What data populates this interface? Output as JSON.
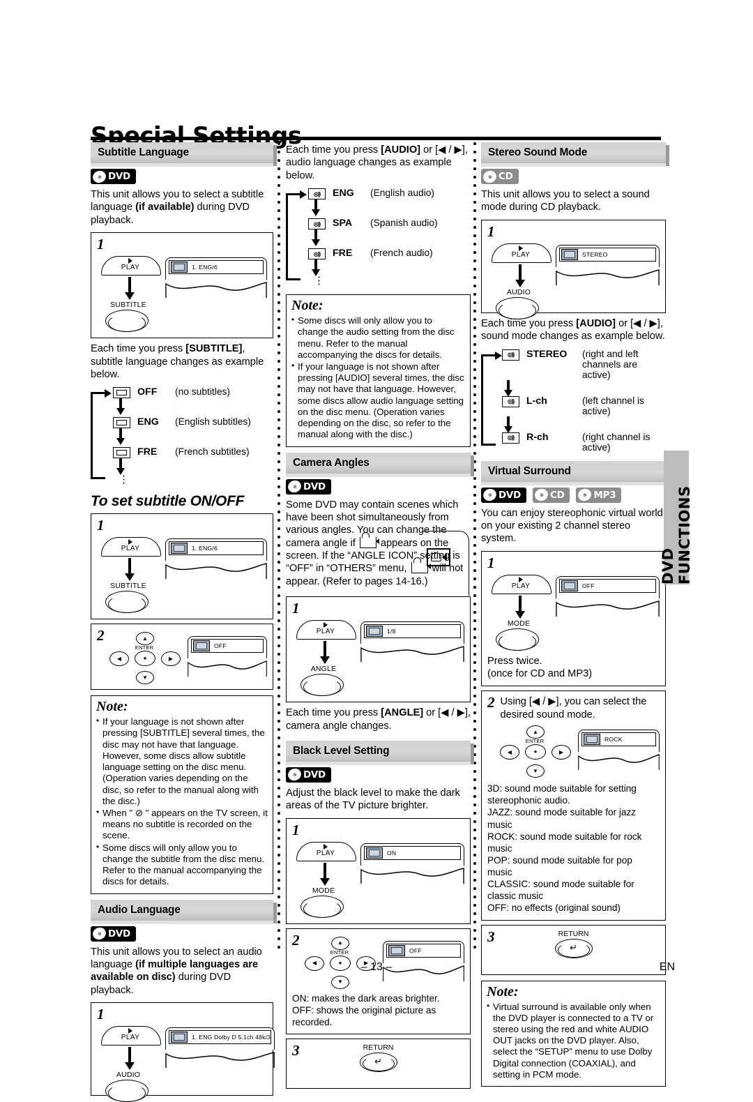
{
  "page": {
    "title": "Special Settings",
    "page_number": "– 13 –",
    "language_mark": "EN",
    "side_tab": "DVD FUNCTIONS"
  },
  "badges": {
    "dvd": "DVD",
    "cd": "CD",
    "mp3": "MP3"
  },
  "keys": {
    "play": "PLAY",
    "subtitle": "SUBTITLE",
    "audio": "AUDIO",
    "angle": "ANGLE",
    "mode": "MODE",
    "return": "RETURN",
    "enter": "ENTER"
  },
  "subtitle_language": {
    "heading": "Subtitle Language",
    "intro_a": "This unit allows you to select a subtitle language ",
    "intro_b": "(if available)",
    "intro_c": " during DVD playback.",
    "step1_num": "1",
    "osd_text": "1. ENG/6",
    "press_text_a": "Each time you press ",
    "press_text_b": "[SUBTITLE]",
    "press_text_c": ", subtitle language changes as example below.",
    "cycle": [
      {
        "code": "OFF",
        "desc": "(no subtitles)"
      },
      {
        "code": "ENG",
        "desc": "(English subtitles)"
      },
      {
        "code": "FRE",
        "desc": "(French subtitles)"
      }
    ],
    "onoff_heading": "To set subtitle ON/OFF",
    "onoff_step1_num": "1",
    "onoff_step1_osd": "1. ENG/6",
    "onoff_step2_num": "2",
    "onoff_step2_osd": "OFF",
    "note_title": "Note:",
    "notes": [
      "If your language is not shown after pressing [SUBTITLE] several times, the disc may not have that language. However, some discs allow subtitle language setting on the disc menu. (Operation varies depending on the disc, so refer to the manual along with the disc.)",
      "When \" ⊘ \" appears on the TV screen, it means no subtitle is recorded on the scene.",
      "Some discs will only allow you to change the subtitle from the disc menu. Refer to the manual accompanying the discs for details."
    ]
  },
  "audio_language": {
    "heading": "Audio Language",
    "intro_a": "This unit allows you to select an audio language ",
    "intro_b": "(if multiple languages are available on disc)",
    "intro_c": " during DVD playback.",
    "step1_num": "1",
    "osd_text": "1. ENG  Dolby D  5.1ch  48k/3",
    "press_text_a": "Each time you press ",
    "press_text_b": "[AUDIO]",
    "press_text_c": " or [◀ / ▶], audio language changes as example below.",
    "cycle": [
      {
        "code": "ENG",
        "desc": "(English audio)"
      },
      {
        "code": "SPA",
        "desc": "(Spanish audio)"
      },
      {
        "code": "FRE",
        "desc": "(French audio)"
      }
    ],
    "note_title": "Note:",
    "notes": [
      "Some discs will only allow you to change the audio setting from the disc menu. Refer to the manual accompanying the discs for details.",
      "If your language is not shown after pressing [AUDIO] several times, the disc may not have that language. However, some discs allow audio language setting on the disc menu. (Operation varies depending on the disc, so refer to the manual along with the disc.)"
    ]
  },
  "camera_angles": {
    "heading": "Camera Angles",
    "text_1": "Some DVD may contain scenes which have been shot simultaneously from various angles. You can change the camera angle if ",
    "text_2": " appears on the screen. If the “ANGLE ICON” setting is “OFF” in “OTHERS” menu, ",
    "text_3": " will not appear. (Refer to pages 14-16.)",
    "step1_num": "1",
    "osd_text": "1/8",
    "press_text_a": "Each time you press ",
    "press_text_b": "[ANGLE]",
    "press_text_c": " or [◀ / ▶], camera angle changes."
  },
  "black_level": {
    "heading": "Black Level Setting",
    "intro": "Adjust the black level to make the dark areas of the TV picture brighter.",
    "step1_num": "1",
    "step1_osd": "ON",
    "step2_num": "2",
    "step2_osd": "OFF",
    "desc_on": "ON: makes the dark areas brighter.",
    "desc_off": "OFF: shows the original picture as recorded.",
    "step3_num": "3"
  },
  "stereo_sound_mode": {
    "heading": "Stereo Sound Mode",
    "intro": "This unit allows you to select a sound mode during CD playback.",
    "step1_num": "1",
    "osd_text": "STEREO",
    "press_text_a": "Each time you press ",
    "press_text_b": "[AUDIO]",
    "press_text_c": " or [◀ / ▶], sound mode changes as example below.",
    "cycle": [
      {
        "code": "STEREO",
        "desc": "(right and left channels are active)"
      },
      {
        "code": "L-ch",
        "desc": "(left channel is active)"
      },
      {
        "code": "R-ch",
        "desc": "(right channel is active)"
      }
    ]
  },
  "virtual_surround": {
    "heading": "Virtual Surround",
    "intro": "You can enjoy stereophonic virtual world on your existing 2 channel stereo system.",
    "step1_num": "1",
    "step1_osd": "OFF",
    "step1_note_1": "Press twice.",
    "step1_note_2": "(once for CD and MP3)",
    "step2_num": "2",
    "step2_text": "Using [◀ / ▶], you can select the desired sound mode.",
    "step2_osd": "ROCK",
    "modes": [
      "3D: sound mode suitable for setting        stereophonic audio.",
      "JAZZ: sound mode suitable for jazz           music",
      "ROCK: sound mode suitable for rock music",
      "POP: sound mode suitable for pop music",
      "CLASSIC: sound mode suitable for                  classic music",
      "OFF: no effects (original sound)"
    ],
    "step3_num": "3",
    "note_title": "Note:",
    "notes": [
      "Virtual surround is available only when the DVD player is connected to a TV or stereo using the red and white AUDIO OUT jacks on the DVD player. Also, select the “SETUP” menu to use Dolby Digital connection (COAXIAL), and setting in PCM mode."
    ]
  }
}
